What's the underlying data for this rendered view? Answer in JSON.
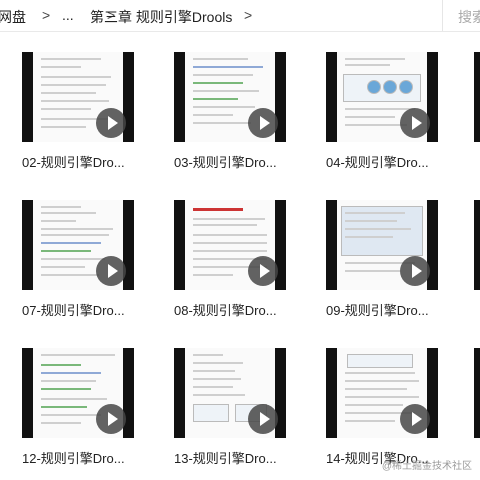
{
  "breadcrumb": {
    "items": [
      "网盘",
      "...",
      "第三章 规则引擎Drools"
    ],
    "separator": ">"
  },
  "search": {
    "label": "搜索"
  },
  "files": [
    {
      "title": "02-规则引擎Dro..."
    },
    {
      "title": "03-规则引擎Dro..."
    },
    {
      "title": "04-规则引擎Dro..."
    },
    {
      "title": "07-规则引擎Dro..."
    },
    {
      "title": "08-规则引擎Dro..."
    },
    {
      "title": "09-规则引擎Dro..."
    },
    {
      "title": "12-规则引擎Dro..."
    },
    {
      "title": "13-规则引擎Dro..."
    },
    {
      "title": "14-规则引擎Dro..."
    }
  ],
  "watermark": "@稀土掘金技术社区"
}
